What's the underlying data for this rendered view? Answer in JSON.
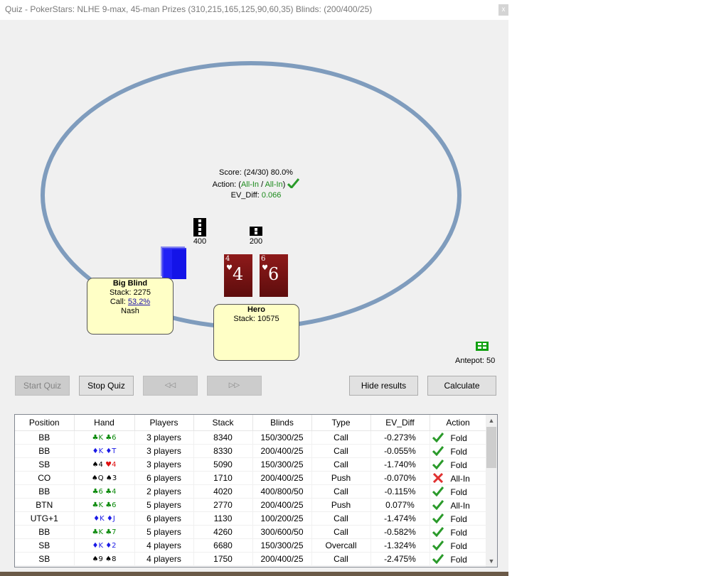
{
  "window": {
    "title": "Quiz - PokerStars: NLHE 9-max, 45-man Prizes (310,215,165,125,90,60,35) Blinds: (200/400/25)",
    "close": "x"
  },
  "center": {
    "score": "Score: (24/30) 80.0%",
    "action_prefix": "Action: (",
    "action_a": "All-In",
    "action_sep": " / ",
    "action_b": "All-In",
    "action_suffix": ")",
    "ev_prefix": "EV_Diff: ",
    "ev_value": "0.066"
  },
  "chips": {
    "left_amount": "400",
    "right_amount": "200"
  },
  "hero_cards": [
    {
      "corner": "4",
      "suit": "♥",
      "rank": "4"
    },
    {
      "corner": "6",
      "suit": "♥",
      "rank": "6"
    }
  ],
  "big_blind": {
    "name": "Big Blind",
    "stack": "Stack: 2275",
    "call_prefix": "Call: ",
    "call_value": "53.2%",
    "strategy": "Nash"
  },
  "hero": {
    "name": "Hero",
    "stack": "Stack: 10575"
  },
  "antepot": "Antepot: 50",
  "buttons": {
    "start_quiz": "Start Quiz",
    "stop_quiz": "Stop Quiz",
    "prev": "◁◁",
    "next": "▷▷",
    "hide_results": "Hide results",
    "calculate": "Calculate"
  },
  "grid": {
    "columns": [
      "Position",
      "Hand",
      "Players",
      "Stack",
      "Blinds",
      "Type",
      "EV_Diff",
      "Action"
    ],
    "rows": [
      {
        "position": "BB",
        "hand": [
          {
            "s": "♣",
            "c": "g"
          },
          {
            "r": "K"
          },
          {
            "s": "♣",
            "c": "g"
          },
          {
            "r": "6"
          }
        ],
        "players": "3 players",
        "stack": "8340",
        "blinds": "150/300/25",
        "type": "Call",
        "ev": "-0.273%",
        "ok": true,
        "action": "Fold"
      },
      {
        "position": "BB",
        "hand": [
          {
            "s": "♦",
            "c": "b"
          },
          {
            "r": "K"
          },
          {
            "s": "♦",
            "c": "b"
          },
          {
            "r": "T"
          }
        ],
        "players": "3 players",
        "stack": "8330",
        "blinds": "200/400/25",
        "type": "Call",
        "ev": "-0.055%",
        "ok": true,
        "action": "Fold"
      },
      {
        "position": "SB",
        "hand": [
          {
            "s": "♠",
            "c": "k"
          },
          {
            "r": "4"
          },
          {
            "s": "♥",
            "c": "r"
          },
          {
            "r": "4"
          }
        ],
        "players": "3 players",
        "stack": "5090",
        "blinds": "150/300/25",
        "type": "Call",
        "ev": "-1.740%",
        "ok": true,
        "action": "Fold"
      },
      {
        "position": "CO",
        "hand": [
          {
            "s": "♠",
            "c": "k"
          },
          {
            "r": "Q"
          },
          {
            "s": "♠",
            "c": "k"
          },
          {
            "r": "3"
          }
        ],
        "players": "6 players",
        "stack": "1710",
        "blinds": "200/400/25",
        "type": "Push",
        "ev": "-0.070%",
        "ok": false,
        "action": "All-In"
      },
      {
        "position": "BB",
        "hand": [
          {
            "s": "♣",
            "c": "g"
          },
          {
            "r": "6"
          },
          {
            "s": "♣",
            "c": "g"
          },
          {
            "r": "4"
          }
        ],
        "players": "2 players",
        "stack": "4020",
        "blinds": "400/800/50",
        "type": "Call",
        "ev": "-0.115%",
        "ok": true,
        "action": "Fold"
      },
      {
        "position": "BTN",
        "hand": [
          {
            "s": "♣",
            "c": "g"
          },
          {
            "r": "K"
          },
          {
            "s": "♣",
            "c": "g"
          },
          {
            "r": "6"
          }
        ],
        "players": "5 players",
        "stack": "2770",
        "blinds": "200/400/25",
        "type": "Push",
        "ev": "0.077%",
        "ok": true,
        "action": "All-In"
      },
      {
        "position": "UTG+1",
        "hand": [
          {
            "s": "♦",
            "c": "b"
          },
          {
            "r": "K"
          },
          {
            "s": "♦",
            "c": "b"
          },
          {
            "r": "J"
          }
        ],
        "players": "6 players",
        "stack": "1130",
        "blinds": "100/200/25",
        "type": "Call",
        "ev": "-1.474%",
        "ok": true,
        "action": "Fold"
      },
      {
        "position": "BB",
        "hand": [
          {
            "s": "♣",
            "c": "g"
          },
          {
            "r": "K"
          },
          {
            "s": "♣",
            "c": "g"
          },
          {
            "r": "7"
          }
        ],
        "players": "5 players",
        "stack": "4260",
        "blinds": "300/600/50",
        "type": "Call",
        "ev": "-0.582%",
        "ok": true,
        "action": "Fold"
      },
      {
        "position": "SB",
        "hand": [
          {
            "s": "♦",
            "c": "b"
          },
          {
            "r": "K"
          },
          {
            "s": "♦",
            "c": "b"
          },
          {
            "r": "2"
          }
        ],
        "players": "4 players",
        "stack": "6680",
        "blinds": "150/300/25",
        "type": "Overcall",
        "ev": "-1.324%",
        "ok": true,
        "action": "Fold"
      },
      {
        "position": "SB",
        "hand": [
          {
            "s": "♠",
            "c": "k"
          },
          {
            "r": "9"
          },
          {
            "s": "♠",
            "c": "k"
          },
          {
            "r": "8"
          }
        ],
        "players": "4 players",
        "stack": "1750",
        "blinds": "200/400/25",
        "type": "Call",
        "ev": "-2.475%",
        "ok": true,
        "action": "Fold"
      }
    ]
  },
  "colors": {
    "table_rail": "#7f9cbd",
    "player_box": "#ffffc6",
    "card": "#7a1313",
    "green": "#1a8a1a"
  },
  "icons": {
    "correct": "check-icon",
    "wrong": "cross-icon",
    "chips": "chip-stack-icon",
    "deck": "deck-icon"
  }
}
